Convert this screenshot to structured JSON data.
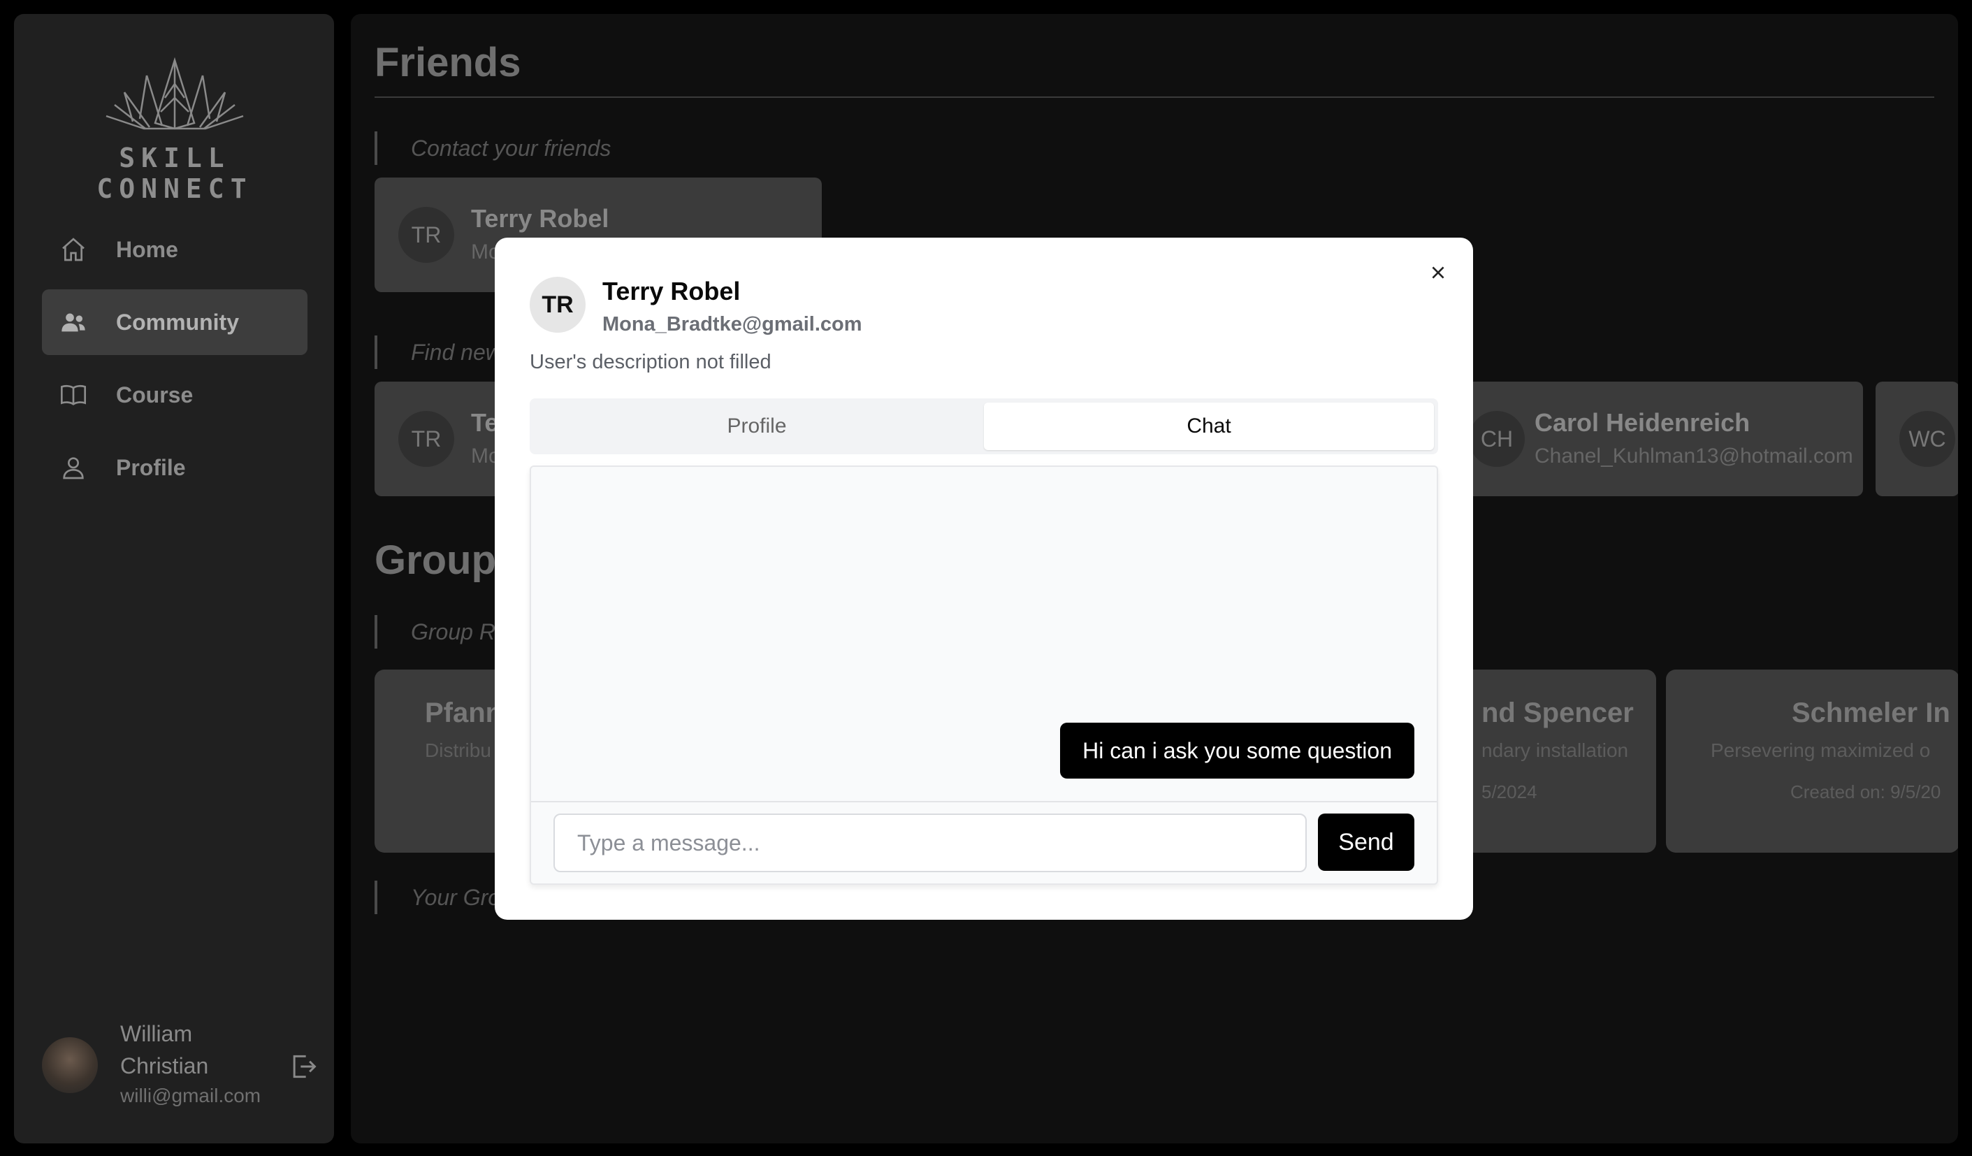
{
  "app": {
    "logo_text": "SKILL CONNECT"
  },
  "sidebar": {
    "items": [
      {
        "label": "Home",
        "icon": "home-icon"
      },
      {
        "label": "Community",
        "icon": "users-icon",
        "active": true
      },
      {
        "label": "Course",
        "icon": "book-icon"
      },
      {
        "label": "Profile",
        "icon": "user-icon"
      }
    ],
    "user": {
      "name": "William Christian",
      "email": "willi@gmail.com"
    }
  },
  "main": {
    "title": "Friends",
    "contact_label": "Contact your friends",
    "friends": [
      {
        "initials": "TR",
        "name": "Terry Robel",
        "email": "Mo"
      }
    ],
    "find_label": "Find new",
    "suggestions": [
      {
        "initials": "TR",
        "name": "Te",
        "email": "Mo"
      },
      {
        "initials": "CH",
        "name": "Carol Heidenreich",
        "email": "Chanel_Kuhlman13@hotmail.com"
      },
      {
        "initials": "WC",
        "name": "",
        "email": ""
      }
    ],
    "groups_title": "Groups",
    "group_rec_label": "Group R",
    "groups": [
      {
        "name": "Pfann",
        "desc": "Distribu",
        "date": ""
      },
      {
        "name": "nd Spencer",
        "desc": "ndary installation",
        "date": "5/2024"
      },
      {
        "name": "Schmeler In",
        "desc": "Persevering maximized o",
        "date": "Created on: 9/5/20"
      }
    ],
    "your_groups_label": "Your Gro"
  },
  "modal": {
    "initials": "TR",
    "name": "Terry Robel",
    "email": "Mona_Bradtke@gmail.com",
    "description": "User's description not filled",
    "tabs": [
      {
        "label": "Profile"
      },
      {
        "label": "Chat",
        "active": true
      }
    ],
    "messages": [
      {
        "text": "Hi can i ask you some question",
        "from": "me"
      }
    ],
    "input_placeholder": "Type a message...",
    "input_value": "",
    "send_label": "Send"
  },
  "colors": {
    "overlay_bg": "#0f0f0f",
    "modal_bg": "#ffffff",
    "accent": "#000000",
    "chat_bg": "#f9fafb"
  }
}
